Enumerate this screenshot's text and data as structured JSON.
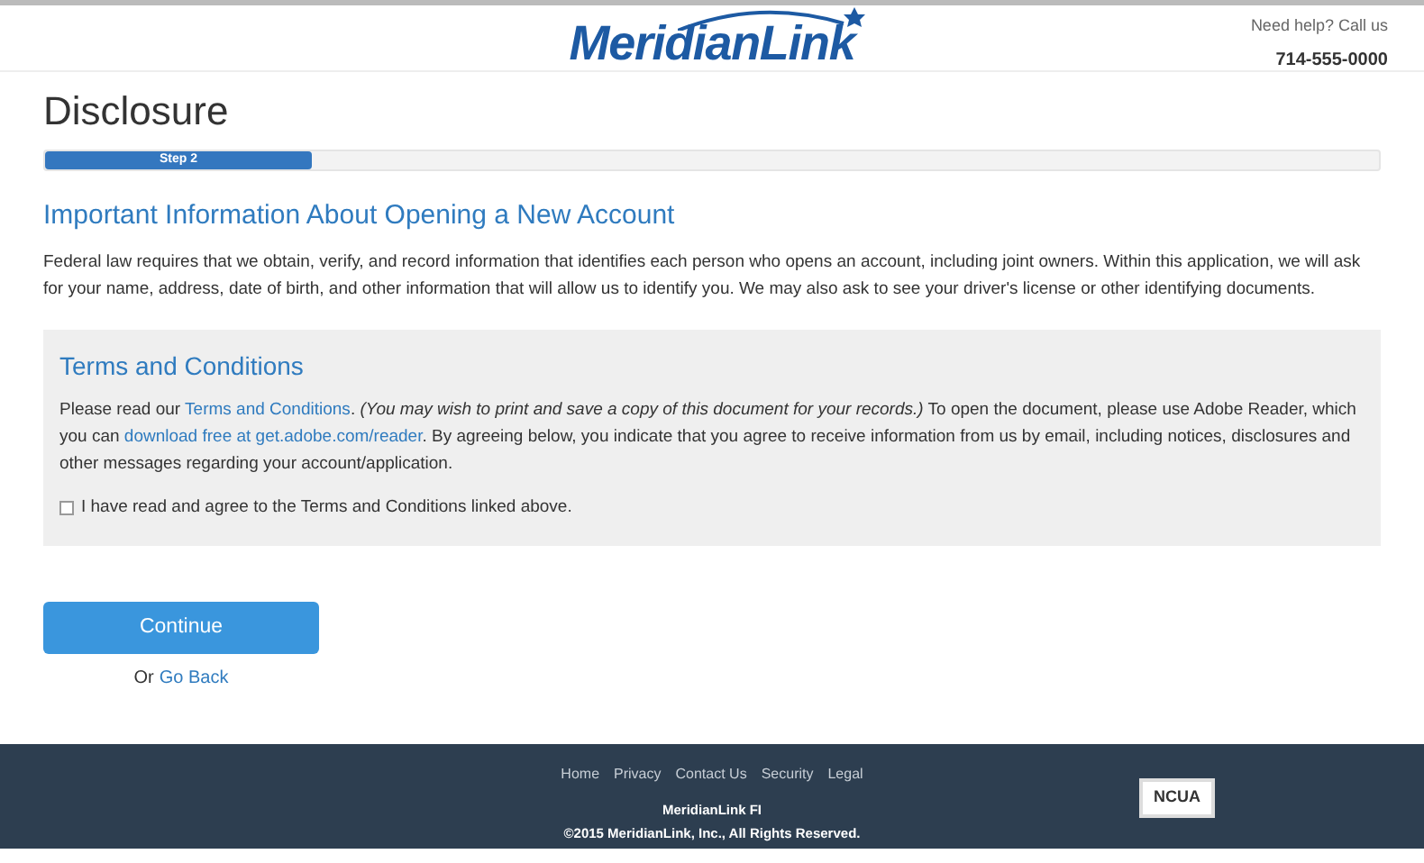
{
  "header": {
    "logo": "MeridianLink",
    "help_text": "Need help? Call us",
    "phone": "714-555-0000"
  },
  "page_title": "Disclosure",
  "progress": {
    "label": "Step 2",
    "level": 0.2
  },
  "notice": {
    "heading": "Important Information About Opening a New Account",
    "body": "Federal law requires that we obtain, verify, and record information that identifies each person who opens an account, including joint owners. Within this application, we will ask for your name, address, date of birth, and other information that will allow us to identify you. We may also ask to see your driver's license or other identifying documents."
  },
  "terms": {
    "heading": "Terms and Conditions",
    "parts": [
      {
        "kind": "text",
        "text": "Please read our "
      },
      {
        "kind": "link",
        "text": "Terms and Conditions"
      },
      {
        "kind": "text",
        "text": ". *(You may wish to print and save a copy of this document for your records.)* To open the document, please use Adobe Reader, which you can "
      },
      {
        "kind": "link",
        "text": "download free at get.adobe.com/reader"
      },
      {
        "kind": "text",
        "text": ". By agreeing below, you indicate that you agree to receive information from us by email, including notices, disclosures and other messages regarding your account/application."
      }
    ],
    "agree": {
      "label": "I have read and agree to the Terms and Conditions linked above.",
      "checked": false
    }
  },
  "continue_button": "Continue",
  "back": {
    "prefix": "Or",
    "link": "Go Back"
  },
  "footer": {
    "links": [
      "Home",
      "Privacy",
      "Contact Us",
      "Security",
      "Legal"
    ],
    "org": "MeridianLink FI",
    "copyright": "©2015 MeridianLink, Inc., All Rights Reserved.",
    "badge": "NCUA"
  }
}
